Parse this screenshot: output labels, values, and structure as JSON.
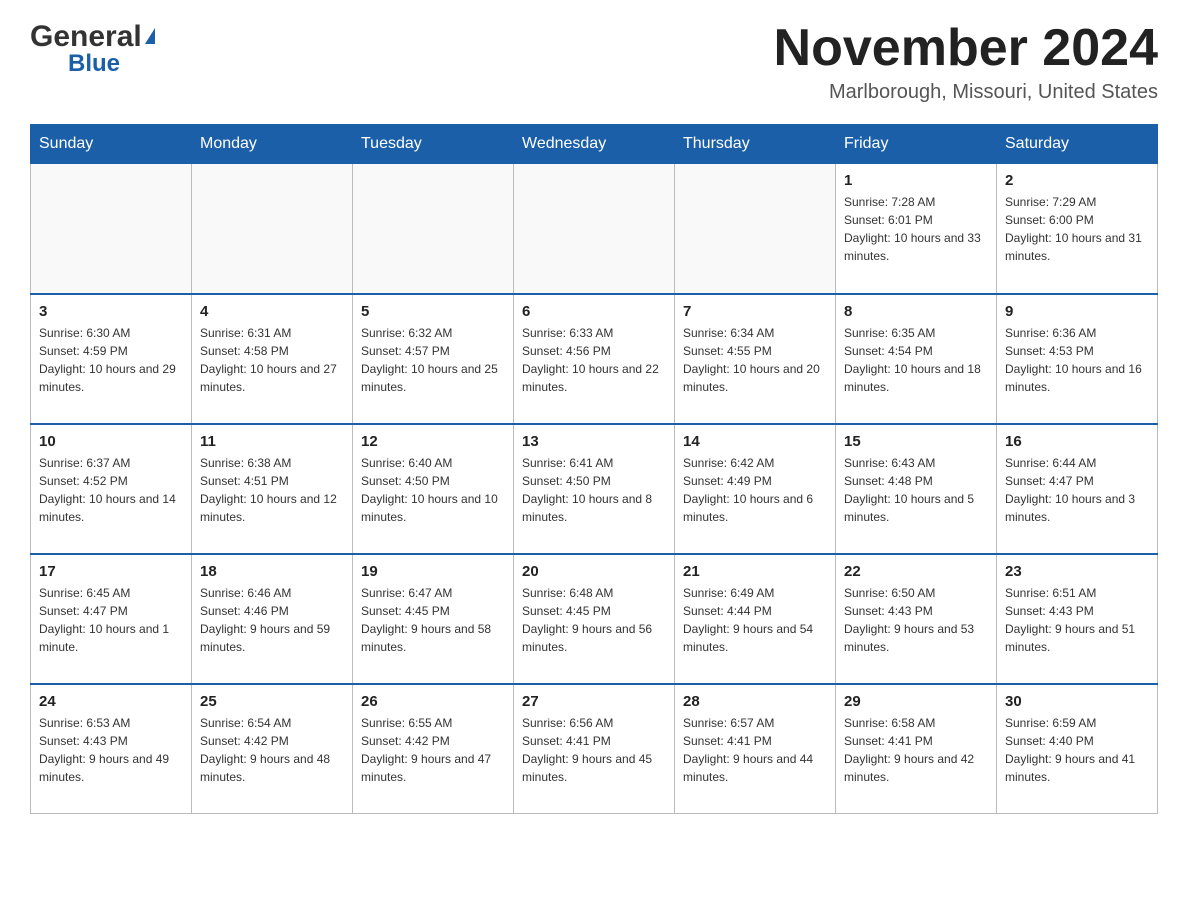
{
  "header": {
    "logo_general": "General",
    "logo_blue": "Blue",
    "month_title": "November 2024",
    "location": "Marlborough, Missouri, United States"
  },
  "days_of_week": [
    "Sunday",
    "Monday",
    "Tuesday",
    "Wednesday",
    "Thursday",
    "Friday",
    "Saturday"
  ],
  "weeks": [
    [
      {
        "day": "",
        "info": ""
      },
      {
        "day": "",
        "info": ""
      },
      {
        "day": "",
        "info": ""
      },
      {
        "day": "",
        "info": ""
      },
      {
        "day": "",
        "info": ""
      },
      {
        "day": "1",
        "info": "Sunrise: 7:28 AM\nSunset: 6:01 PM\nDaylight: 10 hours and 33 minutes."
      },
      {
        "day": "2",
        "info": "Sunrise: 7:29 AM\nSunset: 6:00 PM\nDaylight: 10 hours and 31 minutes."
      }
    ],
    [
      {
        "day": "3",
        "info": "Sunrise: 6:30 AM\nSunset: 4:59 PM\nDaylight: 10 hours and 29 minutes."
      },
      {
        "day": "4",
        "info": "Sunrise: 6:31 AM\nSunset: 4:58 PM\nDaylight: 10 hours and 27 minutes."
      },
      {
        "day": "5",
        "info": "Sunrise: 6:32 AM\nSunset: 4:57 PM\nDaylight: 10 hours and 25 minutes."
      },
      {
        "day": "6",
        "info": "Sunrise: 6:33 AM\nSunset: 4:56 PM\nDaylight: 10 hours and 22 minutes."
      },
      {
        "day": "7",
        "info": "Sunrise: 6:34 AM\nSunset: 4:55 PM\nDaylight: 10 hours and 20 minutes."
      },
      {
        "day": "8",
        "info": "Sunrise: 6:35 AM\nSunset: 4:54 PM\nDaylight: 10 hours and 18 minutes."
      },
      {
        "day": "9",
        "info": "Sunrise: 6:36 AM\nSunset: 4:53 PM\nDaylight: 10 hours and 16 minutes."
      }
    ],
    [
      {
        "day": "10",
        "info": "Sunrise: 6:37 AM\nSunset: 4:52 PM\nDaylight: 10 hours and 14 minutes."
      },
      {
        "day": "11",
        "info": "Sunrise: 6:38 AM\nSunset: 4:51 PM\nDaylight: 10 hours and 12 minutes."
      },
      {
        "day": "12",
        "info": "Sunrise: 6:40 AM\nSunset: 4:50 PM\nDaylight: 10 hours and 10 minutes."
      },
      {
        "day": "13",
        "info": "Sunrise: 6:41 AM\nSunset: 4:50 PM\nDaylight: 10 hours and 8 minutes."
      },
      {
        "day": "14",
        "info": "Sunrise: 6:42 AM\nSunset: 4:49 PM\nDaylight: 10 hours and 6 minutes."
      },
      {
        "day": "15",
        "info": "Sunrise: 6:43 AM\nSunset: 4:48 PM\nDaylight: 10 hours and 5 minutes."
      },
      {
        "day": "16",
        "info": "Sunrise: 6:44 AM\nSunset: 4:47 PM\nDaylight: 10 hours and 3 minutes."
      }
    ],
    [
      {
        "day": "17",
        "info": "Sunrise: 6:45 AM\nSunset: 4:47 PM\nDaylight: 10 hours and 1 minute."
      },
      {
        "day": "18",
        "info": "Sunrise: 6:46 AM\nSunset: 4:46 PM\nDaylight: 9 hours and 59 minutes."
      },
      {
        "day": "19",
        "info": "Sunrise: 6:47 AM\nSunset: 4:45 PM\nDaylight: 9 hours and 58 minutes."
      },
      {
        "day": "20",
        "info": "Sunrise: 6:48 AM\nSunset: 4:45 PM\nDaylight: 9 hours and 56 minutes."
      },
      {
        "day": "21",
        "info": "Sunrise: 6:49 AM\nSunset: 4:44 PM\nDaylight: 9 hours and 54 minutes."
      },
      {
        "day": "22",
        "info": "Sunrise: 6:50 AM\nSunset: 4:43 PM\nDaylight: 9 hours and 53 minutes."
      },
      {
        "day": "23",
        "info": "Sunrise: 6:51 AM\nSunset: 4:43 PM\nDaylight: 9 hours and 51 minutes."
      }
    ],
    [
      {
        "day": "24",
        "info": "Sunrise: 6:53 AM\nSunset: 4:43 PM\nDaylight: 9 hours and 49 minutes."
      },
      {
        "day": "25",
        "info": "Sunrise: 6:54 AM\nSunset: 4:42 PM\nDaylight: 9 hours and 48 minutes."
      },
      {
        "day": "26",
        "info": "Sunrise: 6:55 AM\nSunset: 4:42 PM\nDaylight: 9 hours and 47 minutes."
      },
      {
        "day": "27",
        "info": "Sunrise: 6:56 AM\nSunset: 4:41 PM\nDaylight: 9 hours and 45 minutes."
      },
      {
        "day": "28",
        "info": "Sunrise: 6:57 AM\nSunset: 4:41 PM\nDaylight: 9 hours and 44 minutes."
      },
      {
        "day": "29",
        "info": "Sunrise: 6:58 AM\nSunset: 4:41 PM\nDaylight: 9 hours and 42 minutes."
      },
      {
        "day": "30",
        "info": "Sunrise: 6:59 AM\nSunset: 4:40 PM\nDaylight: 9 hours and 41 minutes."
      }
    ]
  ]
}
